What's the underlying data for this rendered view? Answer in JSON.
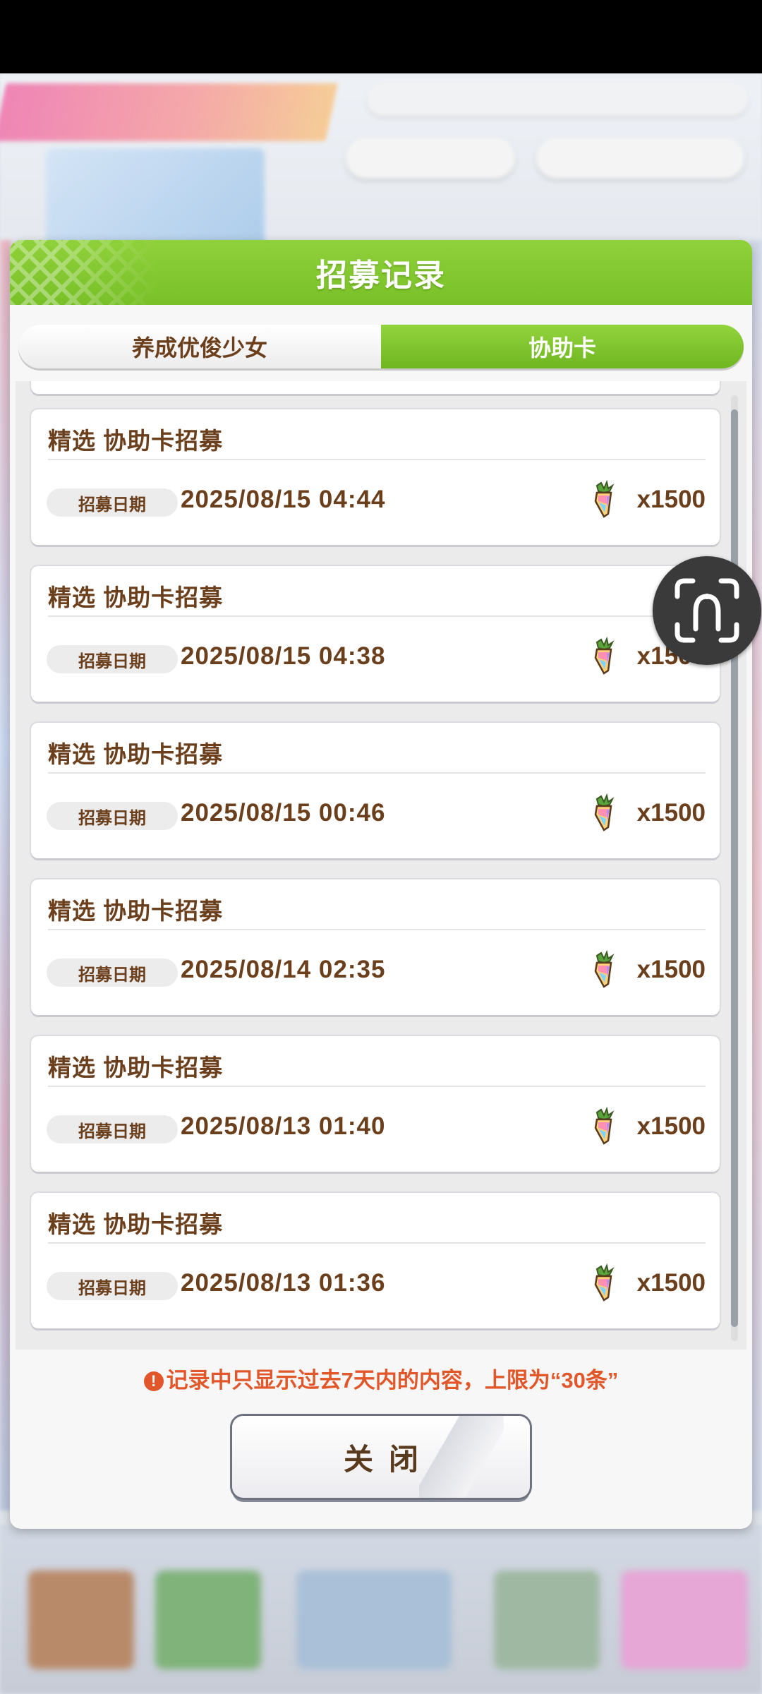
{
  "dialog": {
    "title": "招募记录",
    "tabs": [
      {
        "label": "养成优俊少女",
        "active": false
      },
      {
        "label": "协助卡",
        "active": true
      }
    ],
    "records": [
      {
        "title": "精选  协助卡招募",
        "badge": "招募日期",
        "date": "2025/08/15  04:44",
        "quantity": "x1500"
      },
      {
        "title": "精选  协助卡招募",
        "badge": "招募日期",
        "date": "2025/08/15  04:38",
        "quantity": "x1500"
      },
      {
        "title": "精选  协助卡招募",
        "badge": "招募日期",
        "date": "2025/08/15  00:46",
        "quantity": "x1500"
      },
      {
        "title": "精选  协助卡招募",
        "badge": "招募日期",
        "date": "2025/08/14  02:35",
        "quantity": "x1500"
      },
      {
        "title": "精选  协助卡招募",
        "badge": "招募日期",
        "date": "2025/08/13  01:40",
        "quantity": "x1500"
      },
      {
        "title": "精选  协助卡招募",
        "badge": "招募日期",
        "date": "2025/08/13  01:36",
        "quantity": "x1500"
      }
    ],
    "notice": "记录中只显示过去7天内的内容，上限为“30条”",
    "close_label": "关闭"
  },
  "icons": {
    "currency": "carrot-gem-icon",
    "notice": "exclamation-circle-icon",
    "floating": "horseshoe-assistant-icon"
  },
  "colors": {
    "header_green": "#79c028",
    "text_brown": "#6b3f1c",
    "notice_orange": "#e2572a"
  }
}
